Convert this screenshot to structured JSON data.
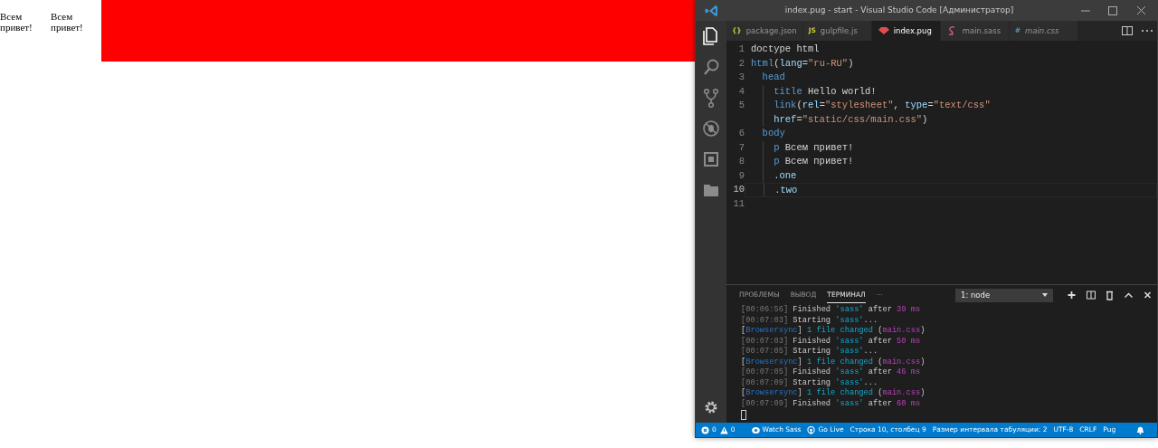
{
  "page": {
    "paragraphs": [
      "Всем привет!",
      "Всем привет!"
    ]
  },
  "window": {
    "title": "index.pug - start - Visual Studio Code [Администратор]"
  },
  "activity_bar": [
    {
      "kind": "files",
      "selected": true
    },
    {
      "kind": "search",
      "selected": false
    },
    {
      "kind": "git",
      "selected": false
    },
    {
      "kind": "debug",
      "selected": false
    },
    {
      "kind": "extensions",
      "selected": false
    },
    {
      "kind": "folder",
      "selected": false
    }
  ],
  "tabs": [
    {
      "kind": "json",
      "glyph": "{}",
      "label": "package.json",
      "selected": false,
      "preview": false
    },
    {
      "kind": "js",
      "glyph": "JS",
      "label": "gulpfile.js",
      "selected": false,
      "preview": false
    },
    {
      "kind": "pug",
      "label": "index.pug",
      "selected": true,
      "preview": false
    },
    {
      "kind": "sass",
      "label": "main.sass",
      "selected": false,
      "preview": false
    },
    {
      "kind": "css",
      "glyph": "#",
      "label": "main.css",
      "selected": false,
      "preview": true
    }
  ],
  "code": [
    {
      "number": "1",
      "current": false,
      "tokens": [
        {
          "kind": "text",
          "text": "doctype html"
        }
      ]
    },
    {
      "number": "2",
      "current": false,
      "tokens": [
        {
          "kind": "tag",
          "text": "html"
        },
        {
          "kind": "text",
          "text": "("
        },
        {
          "kind": "attr",
          "text": "lang"
        },
        {
          "kind": "text",
          "text": "="
        },
        {
          "kind": "string",
          "text": "\"ru-RU\""
        },
        {
          "kind": "text",
          "text": ")"
        }
      ],
      "children": [
        {
          "number": "3",
          "current": false,
          "tokens": [
            {
              "kind": "tag",
              "text": "head"
            }
          ],
          "children": [
            {
              "number": "4",
              "current": false,
              "tokens": [
                {
                  "kind": "tag",
                  "text": "title"
                },
                {
                  "kind": "text",
                  "text": " Hello world!"
                }
              ]
            },
            {
              "number": "5",
              "current": false,
              "tokens": [
                {
                  "kind": "tag",
                  "text": "link"
                },
                {
                  "kind": "text",
                  "text": "("
                },
                {
                  "kind": "attr",
                  "text": "rel"
                },
                {
                  "kind": "text",
                  "text": "="
                },
                {
                  "kind": "string",
                  "text": "\"stylesheet\""
                },
                {
                  "kind": "text",
                  "text": ", "
                },
                {
                  "kind": "attr",
                  "text": "type"
                },
                {
                  "kind": "text",
                  "text": "="
                },
                {
                  "kind": "string",
                  "text": "\"text/css\""
                }
              ],
              "wrap": [
                {
                  "kind": "attr",
                  "text": "href"
                },
                {
                  "kind": "text",
                  "text": "="
                },
                {
                  "kind": "string",
                  "text": "\"static/css/main.css\""
                },
                {
                  "kind": "text",
                  "text": ")"
                }
              ]
            }
          ]
        },
        {
          "number": "6",
          "current": false,
          "tokens": [
            {
              "kind": "tag",
              "text": "body"
            }
          ],
          "children": [
            {
              "number": "7",
              "current": false,
              "tokens": [
                {
                  "kind": "tag",
                  "text": "p"
                },
                {
                  "kind": "text",
                  "text": " Всем привет!"
                }
              ]
            },
            {
              "number": "8",
              "current": false,
              "tokens": [
                {
                  "kind": "tag",
                  "text": "p"
                },
                {
                  "kind": "text",
                  "text": " Всем привет!"
                }
              ]
            },
            {
              "number": "9",
              "current": false,
              "tokens": [
                {
                  "kind": "attr",
                  "text": ".one"
                }
              ]
            },
            {
              "number": "10",
              "current": true,
              "tokens": [
                {
                  "kind": "attr",
                  "text": ".two"
                }
              ]
            }
          ]
        }
      ]
    },
    {
      "number": "11",
      "current": false
    }
  ],
  "panel": {
    "tabs": [
      {
        "label": "ПРОБЛЕМЫ",
        "selected": false
      },
      {
        "label": "ВЫВОД",
        "selected": false
      },
      {
        "label": "ТЕРМИНАЛ",
        "selected": true
      }
    ],
    "more": "···",
    "terminal_select": "1: node"
  },
  "terminal": [
    [
      {
        "kind": "time",
        "text": "[00:06:56]"
      },
      {
        "kind": "text",
        "text": " Finished "
      },
      {
        "kind": "name",
        "text": "'sass'"
      },
      {
        "kind": "text",
        "text": " after "
      },
      {
        "kind": "num",
        "text": "39 ms"
      }
    ],
    [
      {
        "kind": "time",
        "text": "[00:07:03]"
      },
      {
        "kind": "text",
        "text": " Starting "
      },
      {
        "kind": "name",
        "text": "'sass'"
      },
      {
        "kind": "text",
        "text": "..."
      }
    ],
    [
      {
        "kind": "text",
        "text": "["
      },
      {
        "kind": "tag",
        "text": "Browsersync"
      },
      {
        "kind": "text",
        "text": "] "
      },
      {
        "kind": "name",
        "text": "1 file changed"
      },
      {
        "kind": "text",
        "text": " ("
      },
      {
        "kind": "num",
        "text": "main.css"
      },
      {
        "kind": "text",
        "text": ")"
      }
    ],
    [
      {
        "kind": "time",
        "text": "[00:07:03]"
      },
      {
        "kind": "text",
        "text": " Finished "
      },
      {
        "kind": "name",
        "text": "'sass'"
      },
      {
        "kind": "text",
        "text": " after "
      },
      {
        "kind": "num",
        "text": "50 ms"
      }
    ],
    [
      {
        "kind": "time",
        "text": "[00:07:05]"
      },
      {
        "kind": "text",
        "text": " Starting "
      },
      {
        "kind": "name",
        "text": "'sass'"
      },
      {
        "kind": "text",
        "text": "..."
      }
    ],
    [
      {
        "kind": "text",
        "text": "["
      },
      {
        "kind": "tag",
        "text": "Browsersync"
      },
      {
        "kind": "text",
        "text": "] "
      },
      {
        "kind": "name",
        "text": "1 file changed"
      },
      {
        "kind": "text",
        "text": " ("
      },
      {
        "kind": "num",
        "text": "main.css"
      },
      {
        "kind": "text",
        "text": ")"
      }
    ],
    [
      {
        "kind": "time",
        "text": "[00:07:05]"
      },
      {
        "kind": "text",
        "text": " Finished "
      },
      {
        "kind": "name",
        "text": "'sass'"
      },
      {
        "kind": "text",
        "text": " after "
      },
      {
        "kind": "num",
        "text": "46 ms"
      }
    ],
    [
      {
        "kind": "time",
        "text": "[00:07:09]"
      },
      {
        "kind": "text",
        "text": " Starting "
      },
      {
        "kind": "name",
        "text": "'sass'"
      },
      {
        "kind": "text",
        "text": "..."
      }
    ],
    [
      {
        "kind": "text",
        "text": "["
      },
      {
        "kind": "tag",
        "text": "Browsersync"
      },
      {
        "kind": "text",
        "text": "] "
      },
      {
        "kind": "name",
        "text": "1 file changed"
      },
      {
        "kind": "text",
        "text": " ("
      },
      {
        "kind": "num",
        "text": "main.css"
      },
      {
        "kind": "text",
        "text": ")"
      }
    ],
    [
      {
        "kind": "time",
        "text": "[00:07:09]"
      },
      {
        "kind": "text",
        "text": " Finished "
      },
      {
        "kind": "name",
        "text": "'sass'"
      },
      {
        "kind": "text",
        "text": " after "
      },
      {
        "kind": "num",
        "text": "60 ms"
      }
    ]
  ],
  "status_bar": [
    {
      "kind": "errors",
      "text": "0"
    },
    {
      "kind": "warnings",
      "text": "0"
    },
    {
      "kind": "watch",
      "text": "Watch Sass"
    },
    {
      "kind": "live",
      "text": "Go Live"
    },
    {
      "kind": "plain",
      "text": "Строка 10, столбец 9"
    },
    {
      "kind": "plain",
      "text": "Размер интервала табуляции: 2"
    },
    {
      "kind": "plain",
      "text": "UTF-8"
    },
    {
      "kind": "plain",
      "text": "CRLF"
    },
    {
      "kind": "plain",
      "text": "Pug"
    },
    {
      "kind": "bell"
    }
  ]
}
